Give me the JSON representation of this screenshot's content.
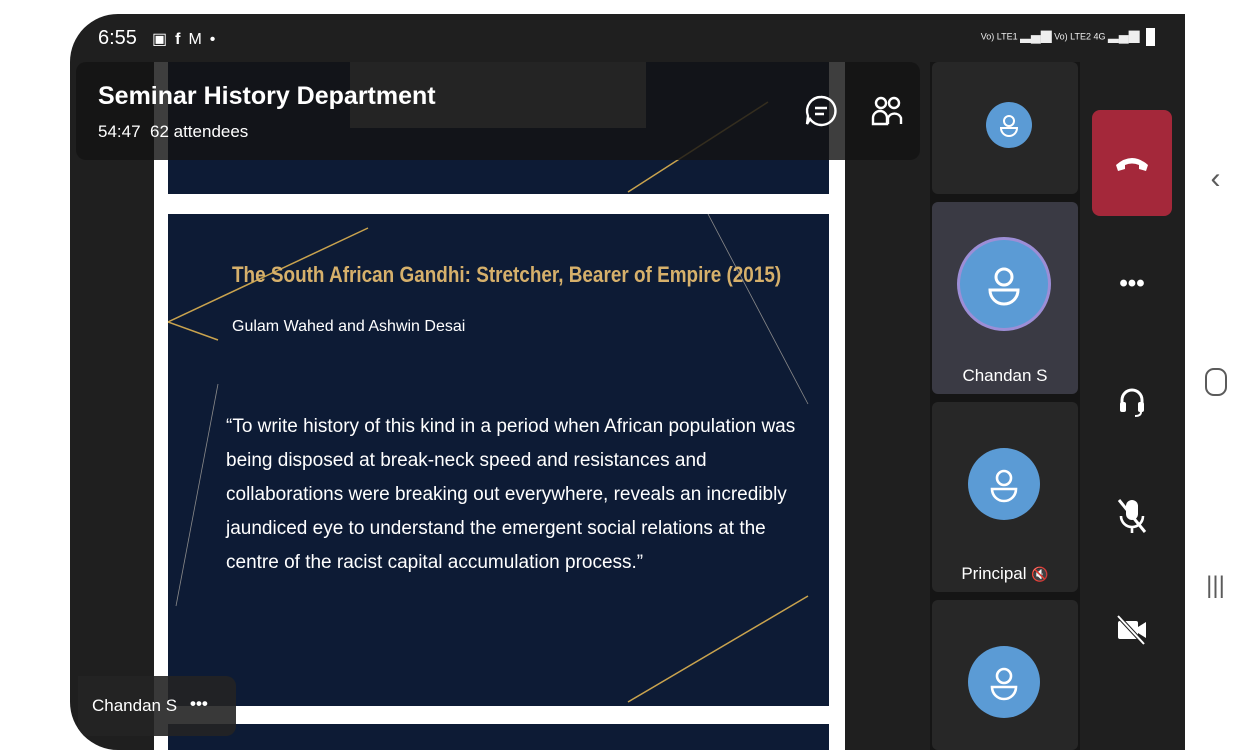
{
  "status_bar": {
    "time": "6:55",
    "signal_1": "Vo) LTE1",
    "signal_2": "Vo) LTE2",
    "network": "4G"
  },
  "meeting": {
    "title": "Seminar History Department",
    "duration": "54:47",
    "attendees": "62 attendees"
  },
  "slide": {
    "title": "The South African Gandhi: Stretcher, Bearer of Empire (2015)",
    "authors": "Gulam Wahed and Ashwin Desai",
    "quote": "“To write history of this kind in a period when African population was being disposed at break-neck speed and resistances and collaborations were breaking out everywhere, reveals an incredibly jaundiced eye to understand the emergent social relations at the centre of the racist capital accumulation process.”"
  },
  "participants": [
    {
      "name": "",
      "active": false
    },
    {
      "name": "Chandan S",
      "active": true
    },
    {
      "name": "Principal",
      "active": false,
      "muted": true
    },
    {
      "name": "",
      "active": false
    }
  ],
  "self_view": {
    "name": "Chandan S",
    "more": "•••"
  },
  "controls": {
    "more": "•••"
  },
  "colors": {
    "end_call": "#a4283a",
    "avatar": "#5b9bd5",
    "slide_bg": "#0d1b35",
    "title_gold": "#d6b06b"
  }
}
